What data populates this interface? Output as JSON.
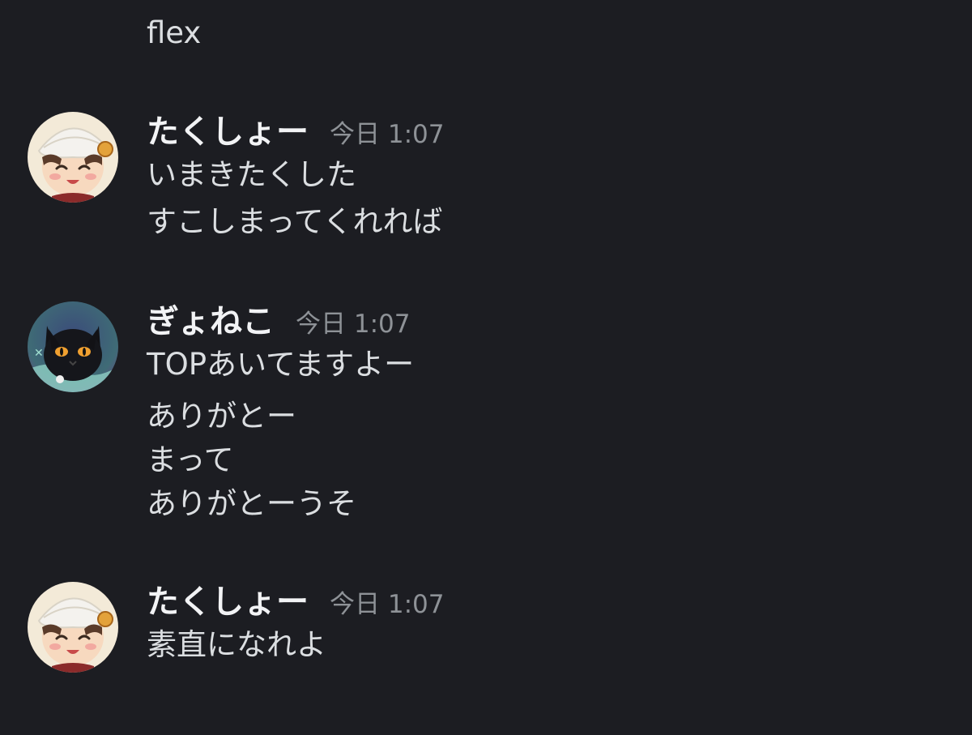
{
  "orphan_message": "flex",
  "messages": [
    {
      "username": "たくしょー",
      "timestamp": "今日 1:07",
      "avatar_icon": "white-turban-chibi-avatar-icon",
      "lines": [
        "いまきたくした",
        "すこしまってくれれば"
      ]
    },
    {
      "username": "ぎょねこ",
      "timestamp": "今日 1:07",
      "avatar_icon": "black-cat-avatar-icon",
      "lines": [
        "TOPあいてますよー",
        "ありがとー",
        "まって",
        "ありがとーうそ"
      ]
    },
    {
      "username": "たくしょー",
      "timestamp": "今日 1:07",
      "avatar_icon": "white-turban-chibi-avatar-icon",
      "lines": [
        "素直になれよ"
      ]
    }
  ],
  "colors": {
    "background": "#1c1d22",
    "username": "#f2f3f5",
    "text": "#dbdee1",
    "timestamp": "#8e9297"
  }
}
